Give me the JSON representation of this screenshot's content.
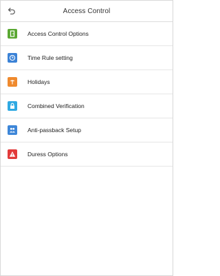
{
  "header": {
    "title": "Access Control",
    "back_icon": "back-arrow-icon"
  },
  "menu": {
    "items": [
      {
        "label": "Access Control Options",
        "icon": "door-icon",
        "color": "#5aa832"
      },
      {
        "label": "Time Rule setting",
        "icon": "clock-icon",
        "color": "#3b82d6"
      },
      {
        "label": "Holidays",
        "icon": "holiday-icon",
        "color": "#ef8a2e"
      },
      {
        "label": "Combined Verification",
        "icon": "lock-icon",
        "color": "#2fa9e2"
      },
      {
        "label": "Anti-passback Setup",
        "icon": "users-icon",
        "color": "#3d86d8"
      },
      {
        "label": "Duress Options",
        "icon": "warning-icon",
        "color": "#e23a3a"
      }
    ]
  }
}
